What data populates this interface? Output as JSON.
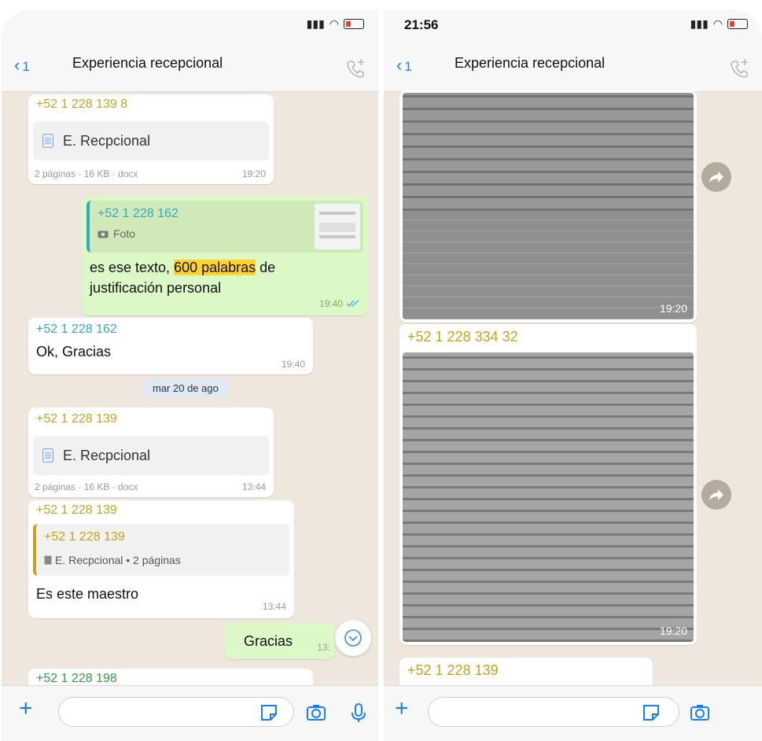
{
  "left": {
    "time": "",
    "back_count": "1",
    "title": "Experiencia recepcional",
    "messages": {
      "m1_sender": "+52 1 228 139 8",
      "m1_doc": "E. Recpcional",
      "m1_info": "2 páginas · 16 KB · docx",
      "m1_time": "19:20",
      "m2_quote_sender": "+52 1 228 162",
      "m2_quote_label": "Foto",
      "m2_text_a": "es ese texto, ",
      "m2_text_highlight": "600 palabras",
      "m2_text_b": " de",
      "m2_text_c": "justificación personal",
      "m2_time": "19:40",
      "m3_sender": "+52 1 228 162",
      "m3_text": "Ok, Gracias",
      "m3_time": "19:40",
      "date_pill": "mar 20 de ago",
      "m4_sender": "+52 1 228 139",
      "m4_doc": "E. Recpcional",
      "m4_info": "2 páginas · 16 KB · docx",
      "m4_time": "13:44",
      "m5_sender": "+52 1 228 139",
      "m5_quote_sender": "+52 1 228 139",
      "m5_quote_text": "E. Recpcional • 2 páginas",
      "m5_text": "Es este maestro",
      "m5_time": "13:44",
      "m6_text": "Gracias",
      "m6_time": "13:",
      "m7_sender": "+52 1 228 198"
    }
  },
  "right": {
    "time": "21:56",
    "back_count": "1",
    "title": "Experiencia recepcional",
    "photo1_time": "19:20",
    "sender2": "+52 1 228 334 32",
    "photo2_time": "19:20",
    "sender3": "+52 1 228 139"
  },
  "colors": {
    "chat_bg": "#efe7de",
    "outgoing": "#dcf8c6",
    "accent_blue": "#157efb",
    "sender_yellow": "#c7a21b",
    "sender_cyan": "#35a7c5",
    "sender_green": "#2f9e44",
    "highlight": "#ffd42a"
  },
  "icons": [
    "back-chevron-icon",
    "add-call-icon",
    "document-icon",
    "camera-icon",
    "double-check-icon",
    "forward-icon",
    "chevron-down-icon",
    "plus-icon",
    "sticker-icon",
    "microphone-icon",
    "signal-icon",
    "wifi-icon",
    "battery-icon"
  ]
}
